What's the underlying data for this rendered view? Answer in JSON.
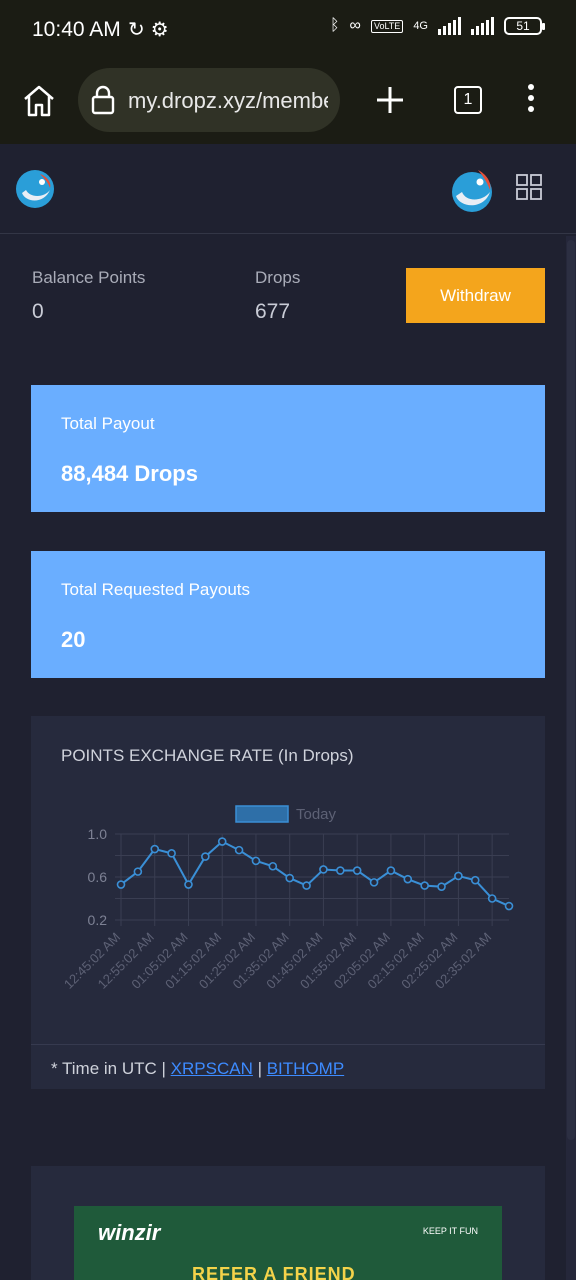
{
  "status_bar": {
    "time": "10:40 AM",
    "battery": "51",
    "network": "4G",
    "volte": "VoLTE"
  },
  "browser": {
    "url": "my.dropz.xyz/membe",
    "tab_count": "1"
  },
  "balance": {
    "points_label": "Balance Points",
    "points_value": "0",
    "drops_label": "Drops",
    "drops_value": "677",
    "withdraw_label": "Withdraw"
  },
  "cards": {
    "total_payout_label": "Total Payout",
    "total_payout_value": "88,484 Drops",
    "requested_label": "Total Requested Payouts",
    "requested_value": "20"
  },
  "chart_data": {
    "type": "line",
    "title": "POINTS EXCHANGE RATE (In Drops)",
    "legend": [
      "Today"
    ],
    "legend_position": "top",
    "y_ticks": [
      "1.0",
      "0.6",
      "0.2"
    ],
    "ylim": [
      0.2,
      1.0
    ],
    "grid": true,
    "x_tick_labels": [
      "12:45:02 AM",
      "12:55:02 AM",
      "01:05:02 AM",
      "01:15:02 AM",
      "01:25:02 AM",
      "01:35:02 AM",
      "01:45:02 AM",
      "01:55:02 AM",
      "02:05:02 AM",
      "02:15:02 AM",
      "02:25:02 AM",
      "02:35:02 AM"
    ],
    "series": [
      {
        "name": "Today",
        "color": "#3a8fd6",
        "values": [
          0.53,
          0.65,
          0.86,
          0.82,
          0.53,
          0.79,
          0.93,
          0.85,
          0.75,
          0.7,
          0.59,
          0.52,
          0.67,
          0.66,
          0.66,
          0.55,
          0.66,
          0.58,
          0.52,
          0.51,
          0.61,
          0.57,
          0.4,
          0.33
        ]
      }
    ]
  },
  "footer": {
    "prefix": "* Time in UTC | ",
    "link1": "XRPSCAN",
    "sep": " | ",
    "link2": "BITHOMP"
  },
  "ad": {
    "brand": "winzir",
    "headline": "REFER A FRIEND",
    "badge": "KEEP IT FUN"
  }
}
